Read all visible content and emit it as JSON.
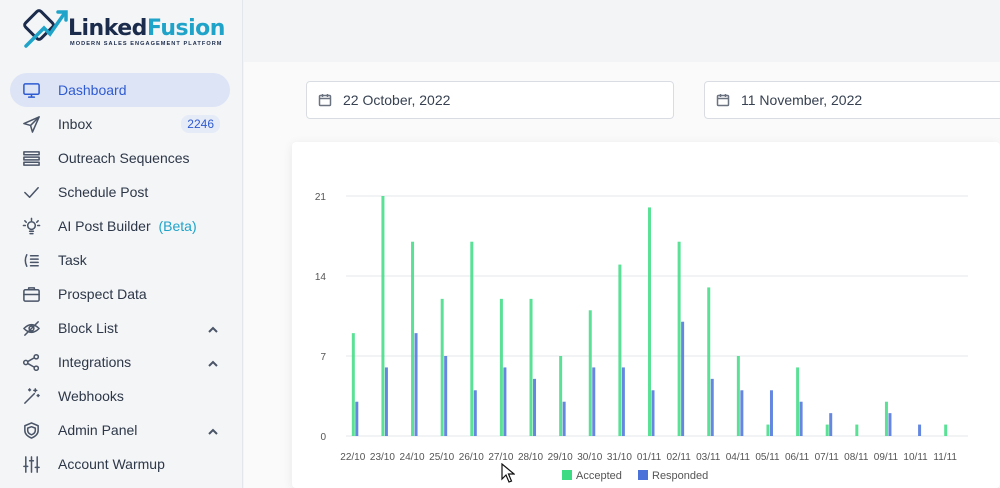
{
  "brand": {
    "name_part1": "Linked",
    "name_part2": "Fusion",
    "tagline": "MODERN SALES ENGAGEMENT PLATFORM"
  },
  "sidebar": {
    "items": [
      {
        "label": "Dashboard",
        "icon": "monitor-icon",
        "active": true
      },
      {
        "label": "Inbox",
        "icon": "send-icon",
        "badge": "2246"
      },
      {
        "label": "Outreach Sequences",
        "icon": "list-icon"
      },
      {
        "label": "Schedule Post",
        "icon": "check-icon"
      },
      {
        "label": "AI Post Builder",
        "icon": "lightbulb-icon",
        "extra": "(Beta)"
      },
      {
        "label": "Task",
        "icon": "task-icon"
      },
      {
        "label": "Prospect Data",
        "icon": "briefcase-icon"
      },
      {
        "label": "Block List",
        "icon": "eye-off-icon",
        "expandable": true
      },
      {
        "label": "Integrations",
        "icon": "share-icon",
        "expandable": true
      },
      {
        "label": "Webhooks",
        "icon": "wand-icon"
      },
      {
        "label": "Admin Panel",
        "icon": "shield-icon",
        "expandable": true
      },
      {
        "label": "Account Warmup",
        "icon": "sliders-icon"
      }
    ]
  },
  "filters": {
    "start_date": "22 October, 2022",
    "end_date": "11 November, 2022"
  },
  "chart_data": {
    "type": "bar",
    "categories": [
      "22/10",
      "23/10",
      "24/10",
      "25/10",
      "26/10",
      "27/10",
      "28/10",
      "29/10",
      "30/10",
      "31/10",
      "01/11",
      "02/11",
      "03/11",
      "04/11",
      "05/11",
      "06/11",
      "07/11",
      "08/11",
      "09/11",
      "10/11",
      "11/11"
    ],
    "series": [
      {
        "name": "Accepted",
        "color": "#3ddc84",
        "values": [
          9,
          21,
          17,
          12,
          17,
          12,
          12,
          7,
          11,
          15,
          20,
          17,
          13,
          7,
          1,
          6,
          1,
          1,
          3,
          0,
          1
        ]
      },
      {
        "name": "Responded",
        "color": "#4a72d9",
        "values": [
          3,
          6,
          9,
          7,
          4,
          6,
          5,
          3,
          6,
          6,
          4,
          10,
          5,
          4,
          4,
          3,
          2,
          0,
          2,
          1,
          0
        ]
      }
    ],
    "yticks": [
      0,
      7,
      14,
      21
    ],
    "ylim": [
      0,
      21
    ],
    "grid": true,
    "legend_position": "bottom"
  }
}
